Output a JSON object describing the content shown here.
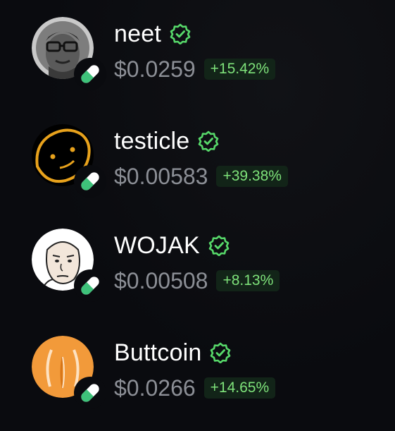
{
  "colors": {
    "background": "#0a0b0f",
    "name_text": "#ffffff",
    "price_text": "#8c8f96",
    "change_text": "#7ee27a",
    "change_bg": "#122418",
    "verified": "#57d96a"
  },
  "tokens": [
    {
      "name": "neet",
      "price": "$0.0259",
      "change": "+15.42%",
      "avatar_icon": "neet-face-avatar",
      "badge_icon": "pill-icon",
      "verified_icon": "verified-badge-icon"
    },
    {
      "name": "testicle",
      "price": "$0.00583",
      "change": "+39.38%",
      "avatar_icon": "testicle-doodle-avatar",
      "badge_icon": "pill-icon",
      "verified_icon": "verified-badge-icon"
    },
    {
      "name": "WOJAK",
      "price": "$0.00508",
      "change": "+8.13%",
      "avatar_icon": "wojak-face-avatar",
      "badge_icon": "pill-icon",
      "verified_icon": "verified-badge-icon"
    },
    {
      "name": "Buttcoin",
      "price": "$0.0266",
      "change": "+14.65%",
      "avatar_icon": "buttcoin-avatar",
      "badge_icon": "pill-icon",
      "verified_icon": "verified-badge-icon"
    }
  ]
}
